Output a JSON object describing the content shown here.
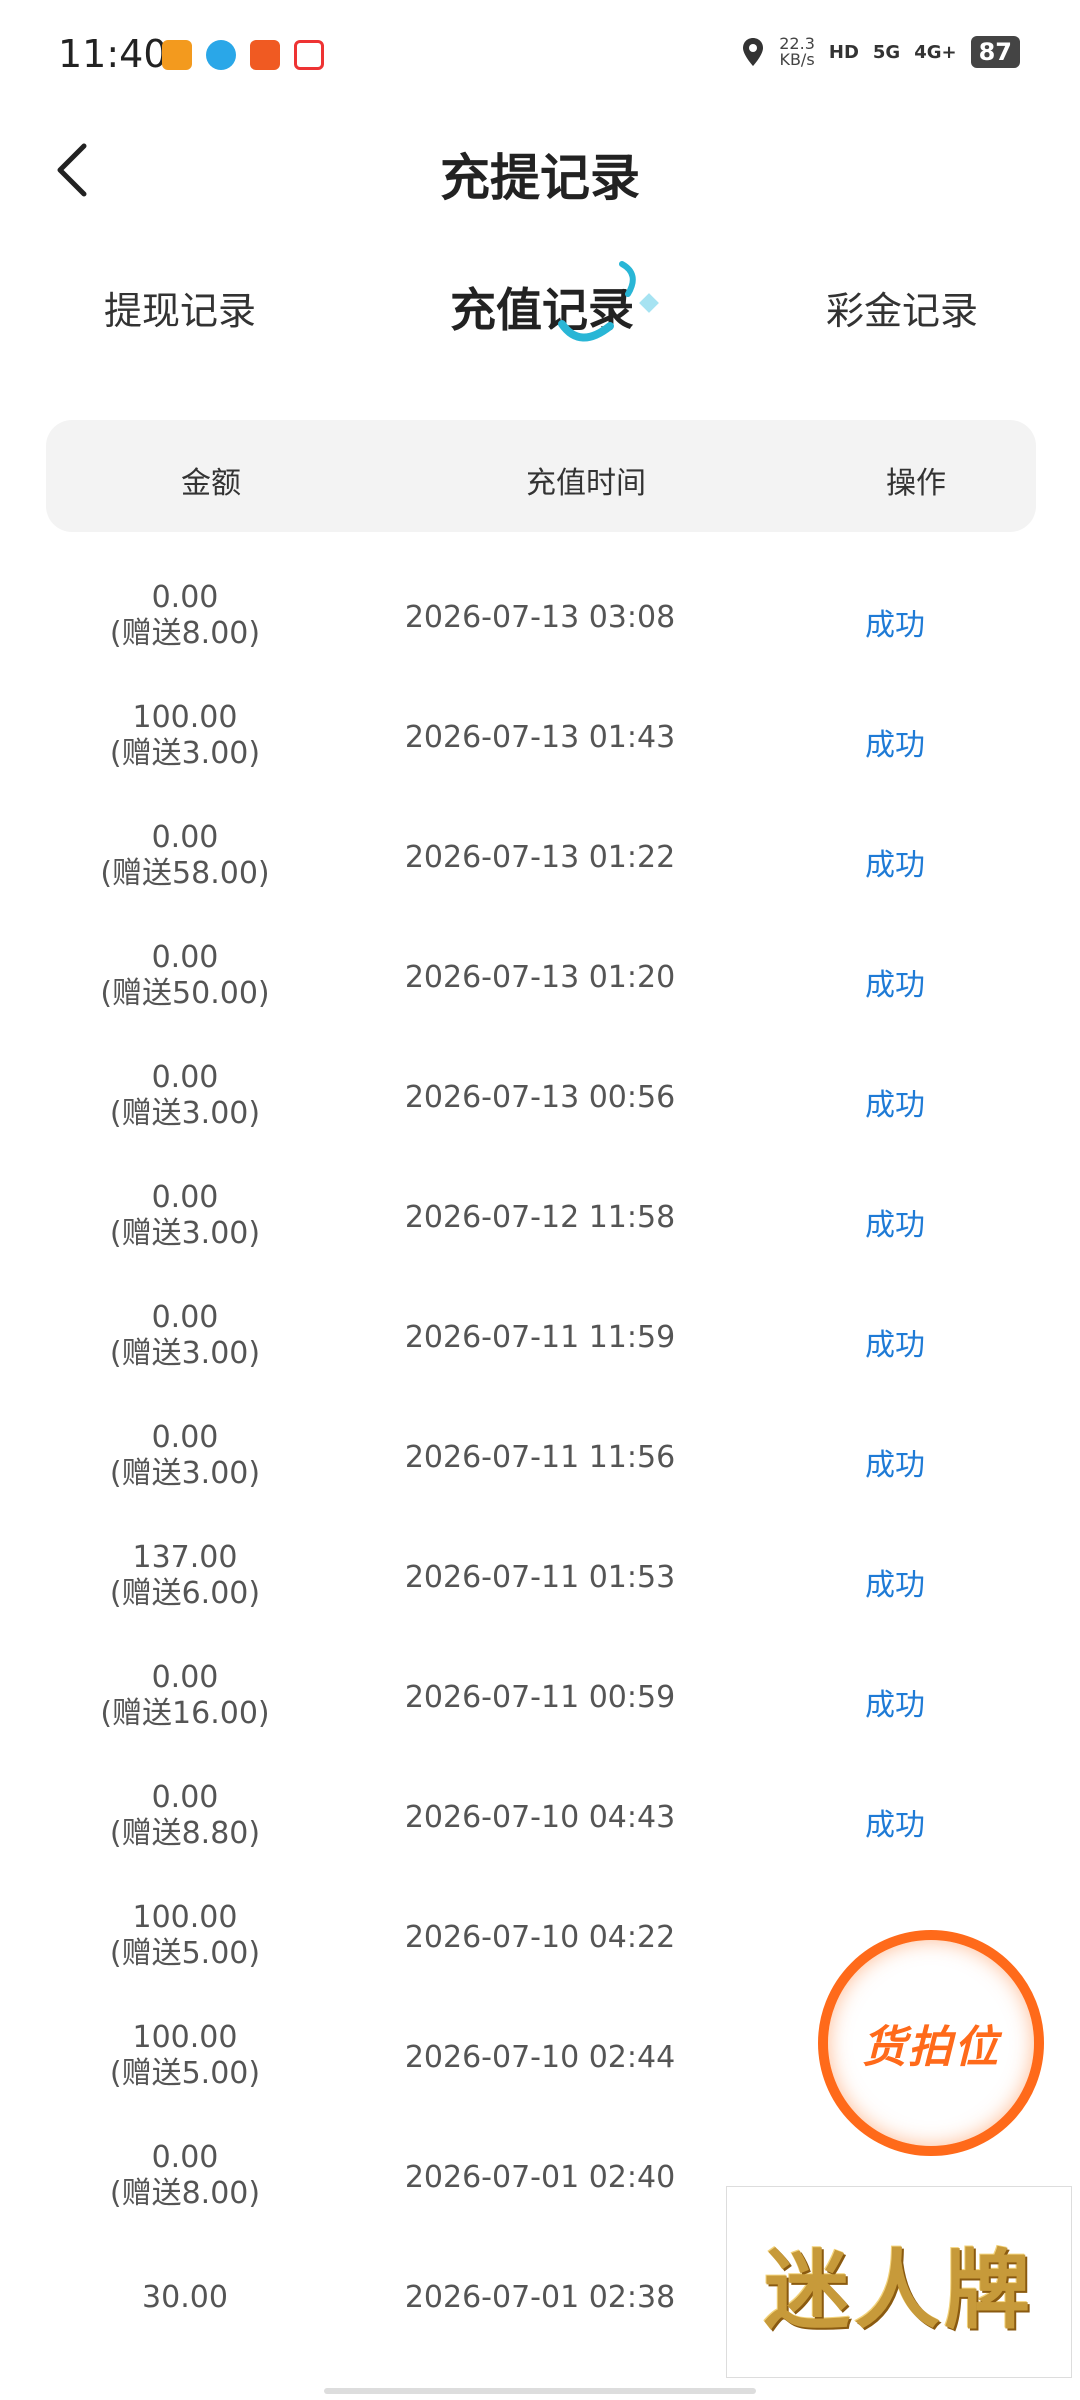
{
  "status_bar": {
    "time": "11:40",
    "net_speed_value": "22.3",
    "net_speed_unit": "KB/s",
    "hd": "HD",
    "sig5g": "5G",
    "sig4g": "4G+",
    "battery": "87"
  },
  "header": {
    "title": "充提记录"
  },
  "tabs": [
    {
      "label": "提现记录",
      "active": false
    },
    {
      "label": "充值记录",
      "active": true
    },
    {
      "label": "彩金记录",
      "active": false
    }
  ],
  "table": {
    "columns": [
      "金额",
      "充值时间",
      "操作"
    ],
    "rows": [
      {
        "amount": "0.00",
        "bonus": "(赠送8.00)",
        "time": "2026-07-13 03:08",
        "status": "成功"
      },
      {
        "amount": "100.00",
        "bonus": "(赠送3.00)",
        "time": "2026-07-13 01:43",
        "status": "成功"
      },
      {
        "amount": "0.00",
        "bonus": "(赠送58.00)",
        "time": "2026-07-13 01:22",
        "status": "成功"
      },
      {
        "amount": "0.00",
        "bonus": "(赠送50.00)",
        "time": "2026-07-13 01:20",
        "status": "成功"
      },
      {
        "amount": "0.00",
        "bonus": "(赠送3.00)",
        "time": "2026-07-13 00:56",
        "status": "成功"
      },
      {
        "amount": "0.00",
        "bonus": "(赠送3.00)",
        "time": "2026-07-12 11:58",
        "status": "成功"
      },
      {
        "amount": "0.00",
        "bonus": "(赠送3.00)",
        "time": "2026-07-11 11:59",
        "status": "成功"
      },
      {
        "amount": "0.00",
        "bonus": "(赠送3.00)",
        "time": "2026-07-11 11:56",
        "status": "成功"
      },
      {
        "amount": "137.00",
        "bonus": "(赠送6.00)",
        "time": "2026-07-11 01:53",
        "status": "成功"
      },
      {
        "amount": "0.00",
        "bonus": "(赠送16.00)",
        "time": "2026-07-11 00:59",
        "status": "成功"
      },
      {
        "amount": "0.00",
        "bonus": "(赠送8.80)",
        "time": "2026-07-10 04:43",
        "status": "成功"
      },
      {
        "amount": "100.00",
        "bonus": "(赠送5.00)",
        "time": "2026-07-10 04:22",
        "status": ""
      },
      {
        "amount": "100.00",
        "bonus": "(赠送5.00)",
        "time": "2026-07-10 02:44",
        "status": ""
      },
      {
        "amount": "0.00",
        "bonus": "(赠送8.00)",
        "time": "2026-07-01 02:40",
        "status": ""
      },
      {
        "amount": "30.00",
        "bonus": "",
        "time": "2026-07-01 02:38",
        "status": ""
      }
    ]
  },
  "float_badge": {
    "text": "货拍位"
  },
  "watermark": {
    "text": "迷人牌"
  },
  "colors": {
    "status_success": "#1f7bd6",
    "accent_cyan": "#29b6d6",
    "badge_orange": "#ff6a1a"
  }
}
